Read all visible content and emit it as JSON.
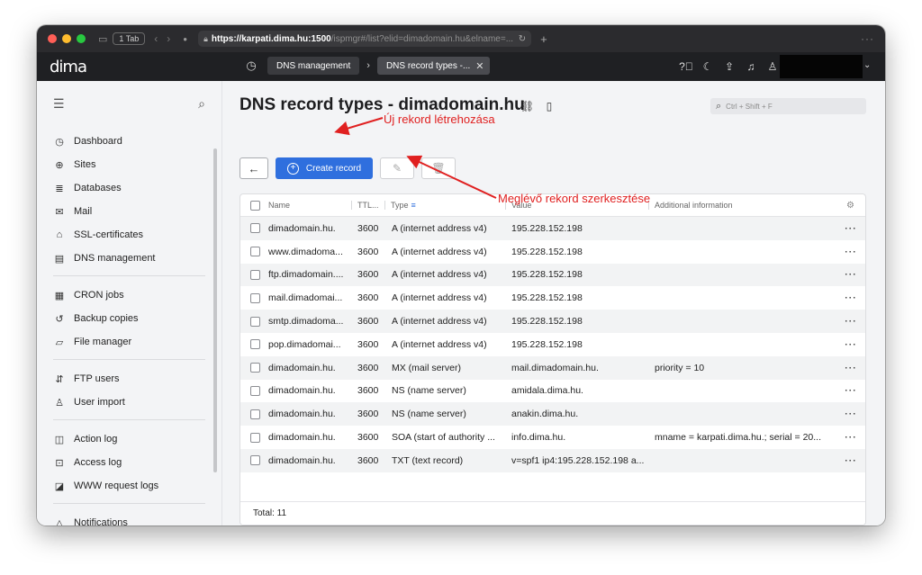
{
  "browser": {
    "tab_count": "1 Tab",
    "url_host": "https://karpati.dima.hu:1500",
    "url_path": "/ispmgr#/list?elid=dimadomain.hu&elname=..."
  },
  "app": {
    "logo": "dima",
    "breadcrumbs": [
      "DNS management",
      "DNS record types -..."
    ]
  },
  "sidebar": {
    "items": [
      {
        "label": "Dashboard",
        "icon": "dashboard-icon"
      },
      {
        "label": "Sites",
        "icon": "globe-icon"
      },
      {
        "label": "Databases",
        "icon": "database-icon"
      },
      {
        "label": "Mail",
        "icon": "mail-icon"
      },
      {
        "label": "SSL-certificates",
        "icon": "lock-icon"
      },
      {
        "label": "DNS management",
        "icon": "dns-icon"
      },
      {
        "label": "CRON jobs",
        "icon": "calendar-icon"
      },
      {
        "label": "Backup copies",
        "icon": "backup-icon"
      },
      {
        "label": "File manager",
        "icon": "folder-icon"
      },
      {
        "label": "FTP users",
        "icon": "ftp-icon"
      },
      {
        "label": "User import",
        "icon": "user-import-icon"
      },
      {
        "label": "Action log",
        "icon": "action-log-icon"
      },
      {
        "label": "Access log",
        "icon": "access-log-icon"
      },
      {
        "label": "WWW request logs",
        "icon": "www-log-icon"
      },
      {
        "label": "Notifications",
        "icon": "bell-icon"
      }
    ]
  },
  "main": {
    "title": "DNS record types - dimadomain.hu",
    "search_placeholder": "Ctrl + Shift + F",
    "create_label": "Create record",
    "annotation_create": "Új rekord létrehozása",
    "annotation_edit": "Meglévő rekord szerkesztése",
    "columns": {
      "name": "Name",
      "ttl": "TTL...",
      "type": "Type",
      "value": "Value",
      "info": "Additional information"
    },
    "rows": [
      {
        "name": "dimadomain.hu.",
        "ttl": "3600",
        "type": "A (internet address v4)",
        "value": "195.228.152.198",
        "info": ""
      },
      {
        "name": "www.dimadoma...",
        "ttl": "3600",
        "type": "A (internet address v4)",
        "value": "195.228.152.198",
        "info": ""
      },
      {
        "name": "ftp.dimadomain....",
        "ttl": "3600",
        "type": "A (internet address v4)",
        "value": "195.228.152.198",
        "info": ""
      },
      {
        "name": "mail.dimadomai...",
        "ttl": "3600",
        "type": "A (internet address v4)",
        "value": "195.228.152.198",
        "info": ""
      },
      {
        "name": "smtp.dimadoma...",
        "ttl": "3600",
        "type": "A (internet address v4)",
        "value": "195.228.152.198",
        "info": ""
      },
      {
        "name": "pop.dimadomai...",
        "ttl": "3600",
        "type": "A (internet address v4)",
        "value": "195.228.152.198",
        "info": ""
      },
      {
        "name": "dimadomain.hu.",
        "ttl": "3600",
        "type": "MX (mail server)",
        "value": "mail.dimadomain.hu.",
        "info": "priority = 10"
      },
      {
        "name": "dimadomain.hu.",
        "ttl": "3600",
        "type": "NS (name server)",
        "value": "amidala.dima.hu.",
        "info": ""
      },
      {
        "name": "dimadomain.hu.",
        "ttl": "3600",
        "type": "NS (name server)",
        "value": "anakin.dima.hu.",
        "info": ""
      },
      {
        "name": "dimadomain.hu.",
        "ttl": "3600",
        "type": "SOA (start of authority ...",
        "value": "info.dima.hu.",
        "info": "mname = karpati.dima.hu.; serial = 20..."
      },
      {
        "name": "dimadomain.hu.",
        "ttl": "3600",
        "type": "TXT (text record)",
        "value": "v=spf1 ip4:195.228.152.198 a...",
        "info": ""
      }
    ],
    "total": "Total: 11"
  },
  "colors": {
    "accent": "#2f6fde",
    "annotation": "#e02020",
    "header_bg": "#1f2023"
  }
}
